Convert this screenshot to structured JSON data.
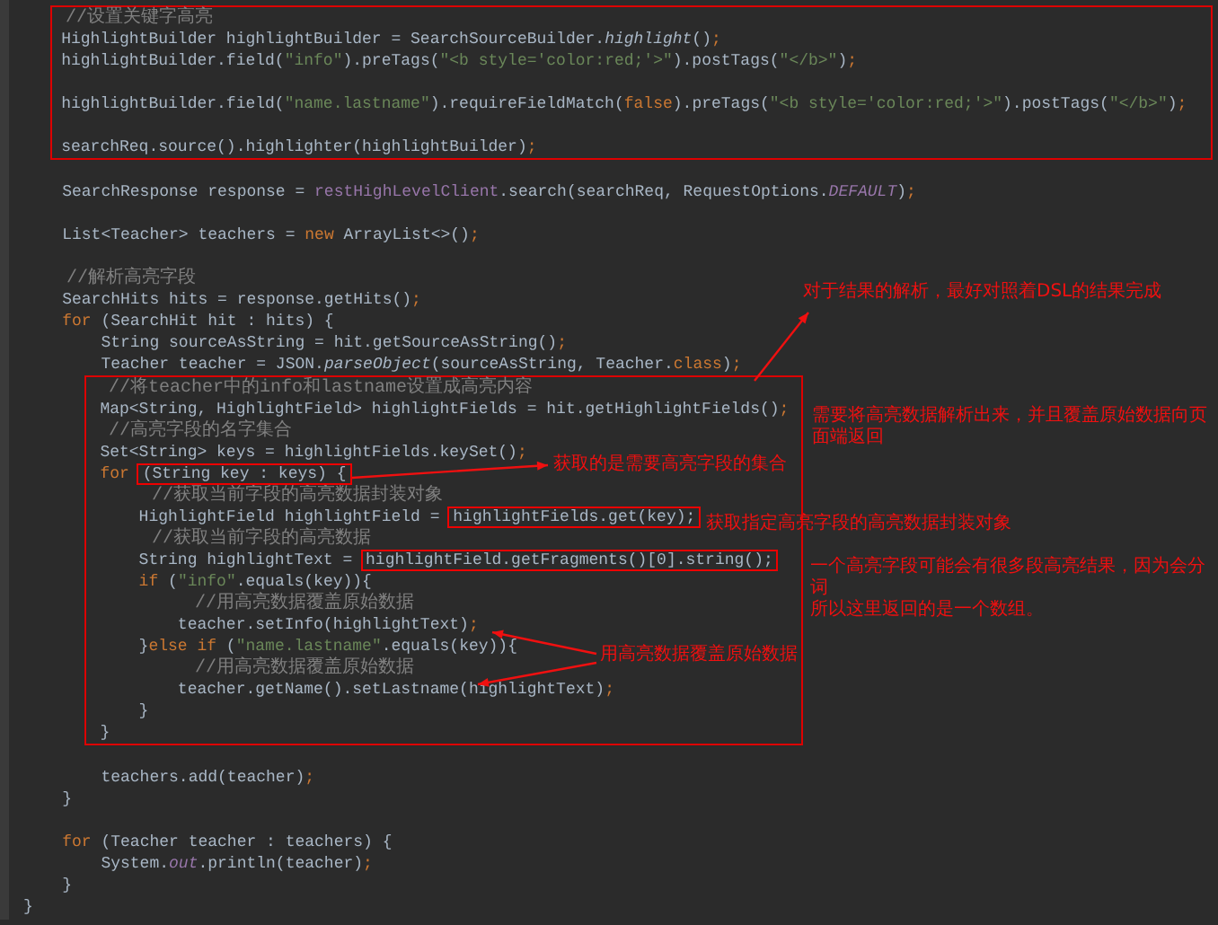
{
  "code_blocks": [
    {
      "kind": "frame-full",
      "lines": [
        {
          "kind": "code",
          "segments": [
            {
              "kind": "comment",
              "text": "    //设置关键字高亮"
            }
          ]
        },
        {
          "kind": "code",
          "segments": [
            {
              "kind": "plain",
              "text": "    HighlightBuilder highlightBuilder = SearchSourceBuilder."
            },
            {
              "kind": "static-method",
              "text": "highlight"
            },
            {
              "kind": "plain",
              "text": "()"
            },
            {
              "kind": "keyword",
              "text": ";"
            }
          ]
        },
        {
          "kind": "code",
          "segments": [
            {
              "kind": "plain",
              "text": "    highlightBuilder.field("
            },
            {
              "kind": "string",
              "text": "\"info\""
            },
            {
              "kind": "plain",
              "text": ").preTags("
            },
            {
              "kind": "string",
              "text": "\"<b style='color:red;'>\""
            },
            {
              "kind": "plain",
              "text": ").postTags("
            },
            {
              "kind": "string",
              "text": "\"</b>\""
            },
            {
              "kind": "plain",
              "text": ")"
            },
            {
              "kind": "keyword",
              "text": ";"
            }
          ]
        },
        {
          "kind": "blank"
        },
        {
          "kind": "code",
          "segments": [
            {
              "kind": "plain",
              "text": "    highlightBuilder.field("
            },
            {
              "kind": "string",
              "text": "\"name.lastname\""
            },
            {
              "kind": "plain",
              "text": ").requireFieldMatch("
            },
            {
              "kind": "keyword",
              "text": "false"
            },
            {
              "kind": "plain",
              "text": ").preTags("
            },
            {
              "kind": "string",
              "text": "\"<b style='color:red;'>\""
            },
            {
              "kind": "plain",
              "text": ").postTags("
            },
            {
              "kind": "string",
              "text": "\"</b>\""
            },
            {
              "kind": "plain",
              "text": ")"
            },
            {
              "kind": "keyword",
              "text": ";"
            }
          ]
        },
        {
          "kind": "blank"
        },
        {
          "kind": "code",
          "segments": [
            {
              "kind": "plain",
              "text": "    searchReq.source().highlighter(highlightBuilder)"
            },
            {
              "kind": "keyword",
              "text": ";"
            }
          ]
        }
      ]
    },
    {
      "kind": "plain",
      "lines": [
        {
          "kind": "blank"
        },
        {
          "kind": "code",
          "segments": [
            {
              "kind": "plain",
              "text": "    SearchResponse response = "
            },
            {
              "kind": "field",
              "text": "restHighLevelClient"
            },
            {
              "kind": "plain",
              "text": ".search(searchReq, RequestOptions."
            },
            {
              "kind": "static-field",
              "text": "DEFAULT"
            },
            {
              "kind": "plain",
              "text": ")"
            },
            {
              "kind": "keyword",
              "text": ";"
            }
          ]
        },
        {
          "kind": "blank"
        },
        {
          "kind": "code",
          "segments": [
            {
              "kind": "plain",
              "text": "    List<Teacher> teachers = "
            },
            {
              "kind": "keyword",
              "text": "new"
            },
            {
              "kind": "plain",
              "text": " ArrayList<>()"
            },
            {
              "kind": "keyword",
              "text": ";"
            }
          ]
        },
        {
          "kind": "blank"
        },
        {
          "kind": "code",
          "segments": [
            {
              "kind": "comment",
              "text": "    //解析高亮字段"
            }
          ]
        },
        {
          "kind": "code",
          "segments": [
            {
              "kind": "plain",
              "text": "    SearchHits hits = response.getHits()"
            },
            {
              "kind": "keyword",
              "text": ";"
            }
          ]
        },
        {
          "kind": "code",
          "segments": [
            {
              "kind": "keyword",
              "text": "    for"
            },
            {
              "kind": "plain",
              "text": " (SearchHit hit : hits) {"
            }
          ]
        },
        {
          "kind": "code",
          "segments": [
            {
              "kind": "plain",
              "text": "        String sourceAsString = hit.getSourceAsString()"
            },
            {
              "kind": "keyword",
              "text": ";"
            }
          ]
        },
        {
          "kind": "code",
          "segments": [
            {
              "kind": "plain",
              "text": "        Teacher teacher = JSON."
            },
            {
              "kind": "static-method",
              "text": "parseObject"
            },
            {
              "kind": "plain",
              "text": "(sourceAsString, Teacher."
            },
            {
              "kind": "keyword",
              "text": "class"
            },
            {
              "kind": "plain",
              "text": ")"
            },
            {
              "kind": "keyword",
              "text": ";"
            }
          ]
        }
      ]
    },
    {
      "kind": "frame-inner",
      "lines": [
        {
          "kind": "code",
          "segments": [
            {
              "kind": "comment",
              "text": "        //将teacher中的info和lastname设置成高亮内容"
            }
          ]
        },
        {
          "kind": "code",
          "segments": [
            {
              "kind": "plain",
              "text": "        Map<String, HighlightField> highlightFields = hit.getHighlightFields()"
            },
            {
              "kind": "keyword",
              "text": ";"
            }
          ]
        },
        {
          "kind": "code",
          "segments": [
            {
              "kind": "comment",
              "text": "        //高亮字段的名字集合"
            }
          ]
        },
        {
          "kind": "code",
          "segments": [
            {
              "kind": "plain",
              "text": "        Set<String> keys = highlightFields.keySet()"
            },
            {
              "kind": "keyword",
              "text": ";"
            }
          ]
        },
        {
          "kind": "code",
          "segments": [
            {
              "kind": "keyword",
              "text": "        for "
            },
            {
              "kind": "boxed",
              "text": "(String key : keys) {"
            }
          ]
        },
        {
          "kind": "code",
          "segments": [
            {
              "kind": "comment",
              "text": "            //获取当前字段的高亮数据封装对象"
            }
          ]
        },
        {
          "kind": "code",
          "segments": [
            {
              "kind": "plain",
              "text": "            HighlightField highlightField = "
            },
            {
              "kind": "boxed",
              "text": "highlightFields.get(key);"
            }
          ]
        },
        {
          "kind": "code",
          "segments": [
            {
              "kind": "comment",
              "text": "            //获取当前字段的高亮数据"
            }
          ]
        },
        {
          "kind": "code",
          "segments": [
            {
              "kind": "plain",
              "text": "            String highlightText = "
            },
            {
              "kind": "boxed",
              "text": "highlightField.getFragments()[0].string();"
            }
          ]
        },
        {
          "kind": "code",
          "segments": [
            {
              "kind": "keyword",
              "text": "            if"
            },
            {
              "kind": "plain",
              "text": " ("
            },
            {
              "kind": "string",
              "text": "\"info\""
            },
            {
              "kind": "plain",
              "text": ".equals(key)){"
            }
          ]
        },
        {
          "kind": "code",
          "segments": [
            {
              "kind": "comment",
              "text": "                //用高亮数据覆盖原始数据"
            }
          ]
        },
        {
          "kind": "code",
          "segments": [
            {
              "kind": "plain",
              "text": "                teacher.setInfo(highlightText)"
            },
            {
              "kind": "keyword",
              "text": ";"
            }
          ]
        },
        {
          "kind": "code",
          "segments": [
            {
              "kind": "plain",
              "text": "            }"
            },
            {
              "kind": "keyword",
              "text": "else if"
            },
            {
              "kind": "plain",
              "text": " ("
            },
            {
              "kind": "string",
              "text": "\"name.lastname\""
            },
            {
              "kind": "plain",
              "text": ".equals(key)){"
            }
          ]
        },
        {
          "kind": "code",
          "segments": [
            {
              "kind": "comment",
              "text": "                //用高亮数据覆盖原始数据"
            }
          ]
        },
        {
          "kind": "code",
          "segments": [
            {
              "kind": "plain",
              "text": "                teacher.getName().setLastname(highlightText)"
            },
            {
              "kind": "keyword",
              "text": ";"
            }
          ]
        },
        {
          "kind": "code",
          "segments": [
            {
              "kind": "plain",
              "text": "            }"
            }
          ]
        },
        {
          "kind": "code",
          "segments": [
            {
              "kind": "plain",
              "text": "        }"
            }
          ]
        }
      ]
    },
    {
      "kind": "plain",
      "lines": [
        {
          "kind": "blank"
        },
        {
          "kind": "code",
          "segments": [
            {
              "kind": "plain",
              "text": "        teachers.add(teacher)"
            },
            {
              "kind": "keyword",
              "text": ";"
            }
          ]
        },
        {
          "kind": "code",
          "segments": [
            {
              "kind": "plain",
              "text": "    }"
            }
          ]
        },
        {
          "kind": "blank"
        },
        {
          "kind": "code",
          "segments": [
            {
              "kind": "keyword",
              "text": "    for"
            },
            {
              "kind": "plain",
              "text": " (Teacher teacher : teachers) {"
            }
          ]
        },
        {
          "kind": "code",
          "segments": [
            {
              "kind": "plain",
              "text": "        System."
            },
            {
              "kind": "static-field",
              "text": "out"
            },
            {
              "kind": "plain",
              "text": ".println(teacher)"
            },
            {
              "kind": "keyword",
              "text": ";"
            }
          ]
        },
        {
          "kind": "code",
          "segments": [
            {
              "kind": "plain",
              "text": "    }"
            }
          ]
        },
        {
          "kind": "code",
          "segments": [
            {
              "kind": "plain",
              "text": "}"
            }
          ]
        }
      ]
    }
  ],
  "annotations": [
    {
      "lines": [
        "对于结果的解析，最好对照着DSL的结果完成"
      ]
    },
    {
      "lines": [
        "需要将高亮数据解析出来，并且覆盖原始数据向页面端返回"
      ]
    },
    {
      "lines": [
        "获取的是需要高亮字段的集合"
      ]
    },
    {
      "lines": [
        "获取指定高亮字段的高亮数据封装对象"
      ]
    },
    {
      "lines": [
        "一个高亮字段可能会有很多段高亮结果，因为会分词",
        "所以这里返回的是一个数组。"
      ]
    },
    {
      "lines": [
        "用高亮数据覆盖原始数据"
      ]
    }
  ]
}
